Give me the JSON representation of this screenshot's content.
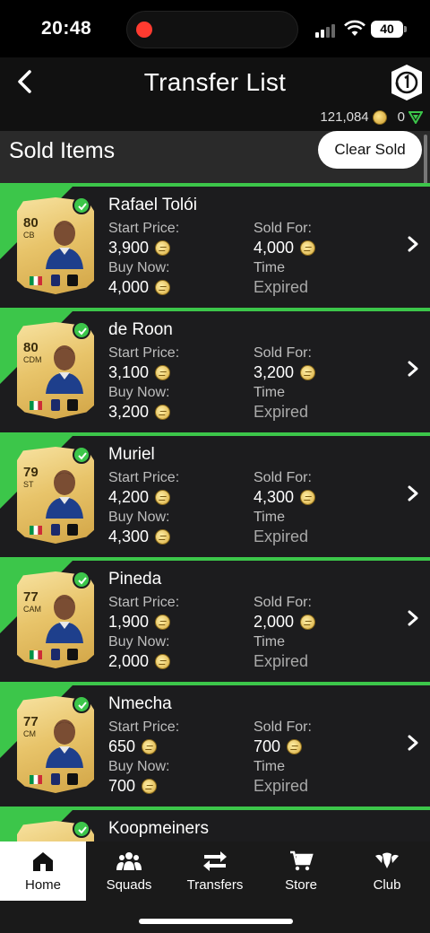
{
  "status_bar": {
    "time": "20:48",
    "battery": "40"
  },
  "header": {
    "title": "Transfer List",
    "coins": "121,084",
    "points": "0"
  },
  "section": {
    "title": "Sold Items",
    "clear_label": "Clear Sold"
  },
  "labels": {
    "start_price": "Start Price:",
    "buy_now": "Buy Now:",
    "sold_for": "Sold For:",
    "time": "Time",
    "expired": "Expired"
  },
  "items": [
    {
      "name": "Rafael Tolói",
      "rating": "80",
      "position": "CB",
      "start_price": "3,900",
      "buy_now": "4,000",
      "sold_for": "4,000"
    },
    {
      "name": "de Roon",
      "rating": "80",
      "position": "CDM",
      "start_price": "3,100",
      "buy_now": "3,200",
      "sold_for": "3,200"
    },
    {
      "name": "Muriel",
      "rating": "79",
      "position": "ST",
      "start_price": "4,200",
      "buy_now": "4,300",
      "sold_for": "4,300"
    },
    {
      "name": "Pineda",
      "rating": "77",
      "position": "CAM",
      "start_price": "1,900",
      "buy_now": "2,000",
      "sold_for": "2,000"
    },
    {
      "name": "Nmecha",
      "rating": "77",
      "position": "CM",
      "start_price": "650",
      "buy_now": "700",
      "sold_for": "700"
    },
    {
      "name": "Koopmeiners",
      "rating": "",
      "position": "",
      "start_price": "",
      "buy_now": "",
      "sold_for": ""
    }
  ],
  "nav": [
    {
      "label": "Home",
      "icon": "home-icon"
    },
    {
      "label": "Squads",
      "icon": "squads-icon"
    },
    {
      "label": "Transfers",
      "icon": "transfers-icon"
    },
    {
      "label": "Store",
      "icon": "store-icon"
    },
    {
      "label": "Club",
      "icon": "club-icon"
    }
  ]
}
